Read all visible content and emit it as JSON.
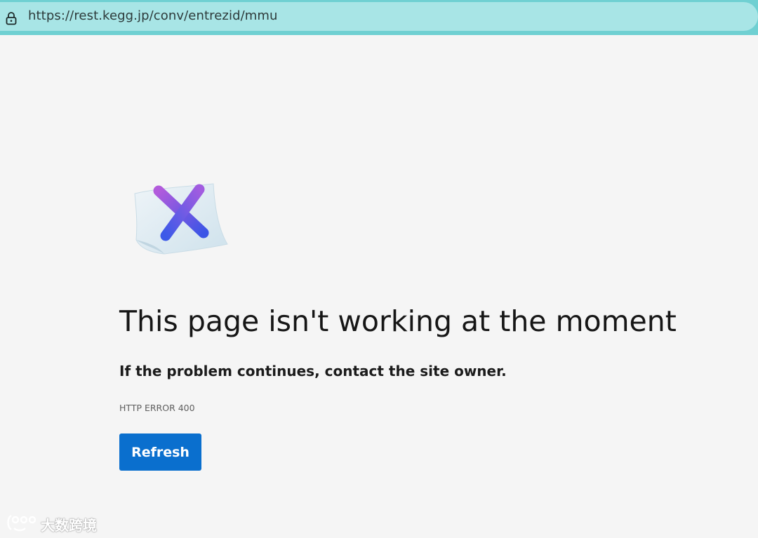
{
  "browser": {
    "url": "https://rest.kegg.jp/conv/entrezid/mmu",
    "lock_icon": "lock-icon"
  },
  "error_page": {
    "illustration_icon": "error-x-paper-icon",
    "headline": "This page isn't working at the moment",
    "subtext": "If the problem continues, contact the site owner.",
    "error_code": "HTTP ERROR 400",
    "refresh_label": "Refresh",
    "accent_color": "#0a6fce"
  },
  "watermark": {
    "text": "大数跨境",
    "icon": "watermark-logo-icon"
  }
}
